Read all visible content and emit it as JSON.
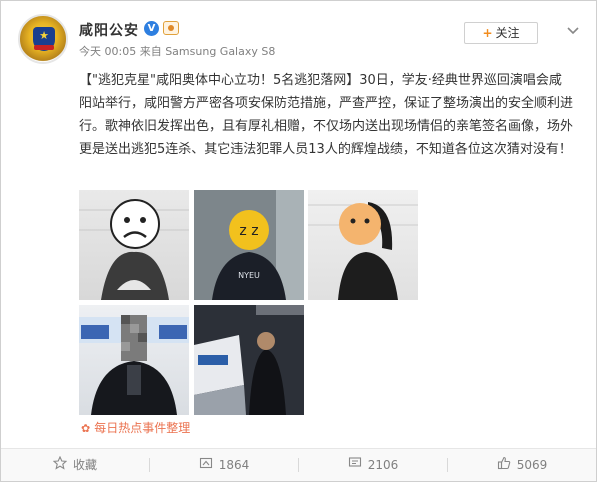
{
  "post": {
    "author": "咸阳公安",
    "time": "今天 00:05",
    "source_prefix": "来自",
    "device": "Samsung Galaxy S8",
    "follow_label": "关注",
    "follow_plus": "+",
    "topic": "【\"逃犯克星\"咸阳奥体中心立功！5名逃犯落网】",
    "text": "30日，学友·经典世界巡回演唱会咸阳站举行，咸阳警方严密各项安保防范措施，严查严控，保证了整场演出的安全顺利进行。歌神依旧发挥出色，且有厚礼相赠，不仅场内送出现场情侣的亲笔签名画像，场外更是送出逃犯5连杀、其它违法犯罪人员13人的辉煌战绩，不知道各位这次猜对没有！",
    "source_tag": "每日热点事件整理",
    "icons": {
      "verified": "verified-v-icon",
      "badge": "gov-badge-icon",
      "menu": "chevron-down-icon"
    }
  },
  "footer": {
    "favorite_label": "收藏",
    "repost_count": "1864",
    "comment_count": "2106",
    "like_count": "5069"
  },
  "colors": {
    "accent_orange": "#eb7350",
    "follow_plus": "#f28c1e",
    "verified_blue": "#2e7fe0",
    "muted_text": "#808080"
  }
}
